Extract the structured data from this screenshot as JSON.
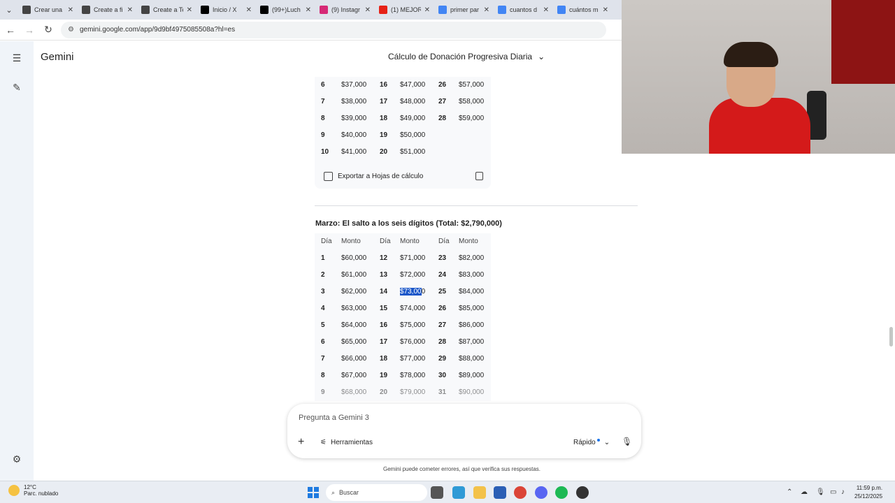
{
  "browser": {
    "tabs": [
      {
        "label": "Crear una",
        "icon": "sheets-icon",
        "color": "#444"
      },
      {
        "label": "Create a fi",
        "icon": "sheets-icon",
        "color": "#444"
      },
      {
        "label": "Create a Te",
        "icon": "sheets-icon",
        "color": "#444"
      },
      {
        "label": "Inicio / X",
        "icon": "x-icon",
        "color": "#000"
      },
      {
        "label": "(99+)Luch",
        "icon": "tiktok-icon",
        "color": "#000"
      },
      {
        "label": "(9) Instagr",
        "icon": "instagram-icon",
        "color": "#d62976"
      },
      {
        "label": "(1) MEJOR",
        "icon": "youtube-icon",
        "color": "#e62117"
      },
      {
        "label": "primer par",
        "icon": "google-icon",
        "color": "#4285f4"
      },
      {
        "label": "cuantos d",
        "icon": "google-icon",
        "color": "#4285f4"
      },
      {
        "label": "cuántos m",
        "icon": "google-icon",
        "color": "#4285f4"
      }
    ],
    "url": "gemini.google.com/app/9d9bf4975085508a?hl=es"
  },
  "app": {
    "name": "Gemini",
    "conversation_title": "Cálculo de Donación Progresiva Diaria"
  },
  "febrero_table": {
    "rows": [
      [
        "6",
        "$37,000",
        "16",
        "$47,000",
        "26",
        "$57,000"
      ],
      [
        "7",
        "$38,000",
        "17",
        "$48,000",
        "27",
        "$58,000"
      ],
      [
        "8",
        "$39,000",
        "18",
        "$49,000",
        "28",
        "$59,000"
      ],
      [
        "9",
        "$40,000",
        "19",
        "$50,000",
        "",
        ""
      ],
      [
        "10",
        "$41,000",
        "20",
        "$51,000",
        "",
        ""
      ]
    ],
    "export_label": "Exportar a Hojas de cálculo"
  },
  "marzo": {
    "heading": "Marzo: El salto a los seis dígitos (Total: $2,790,000)",
    "headers": [
      "Día",
      "Monto",
      "Día",
      "Monto",
      "Día",
      "Monto"
    ],
    "rows": [
      [
        "1",
        "$60,000",
        "12",
        "$71,000",
        "23",
        "$82,000"
      ],
      [
        "2",
        "$61,000",
        "13",
        "$72,000",
        "24",
        "$83,000"
      ],
      [
        "3",
        "$62,000",
        "14",
        "$73,000",
        "25",
        "$84,000"
      ],
      [
        "4",
        "$63,000",
        "15",
        "$74,000",
        "26",
        "$85,000"
      ],
      [
        "5",
        "$64,000",
        "16",
        "$75,000",
        "27",
        "$86,000"
      ],
      [
        "6",
        "$65,000",
        "17",
        "$76,000",
        "28",
        "$87,000"
      ],
      [
        "7",
        "$66,000",
        "18",
        "$77,000",
        "29",
        "$88,000"
      ],
      [
        "8",
        "$67,000",
        "19",
        "$78,000",
        "30",
        "$89,000"
      ],
      [
        "9",
        "$68,000",
        "20",
        "$79,000",
        "31",
        "$90,000"
      ]
    ],
    "selected_text": "$73,00",
    "selected_rest": "0"
  },
  "prompt": {
    "placeholder": "Pregunta a Gemini 3",
    "tools_label": "Herramientas",
    "mode_label": "Rápido",
    "disclaimer": "Gemini puede cometer errores, así que verifica sus respuestas."
  },
  "taskbar": {
    "temperature": "12°C",
    "weather": "Parc. nublado",
    "search_label": "Buscar",
    "time": "11:59 p.m.",
    "date": "25/12/2025"
  }
}
